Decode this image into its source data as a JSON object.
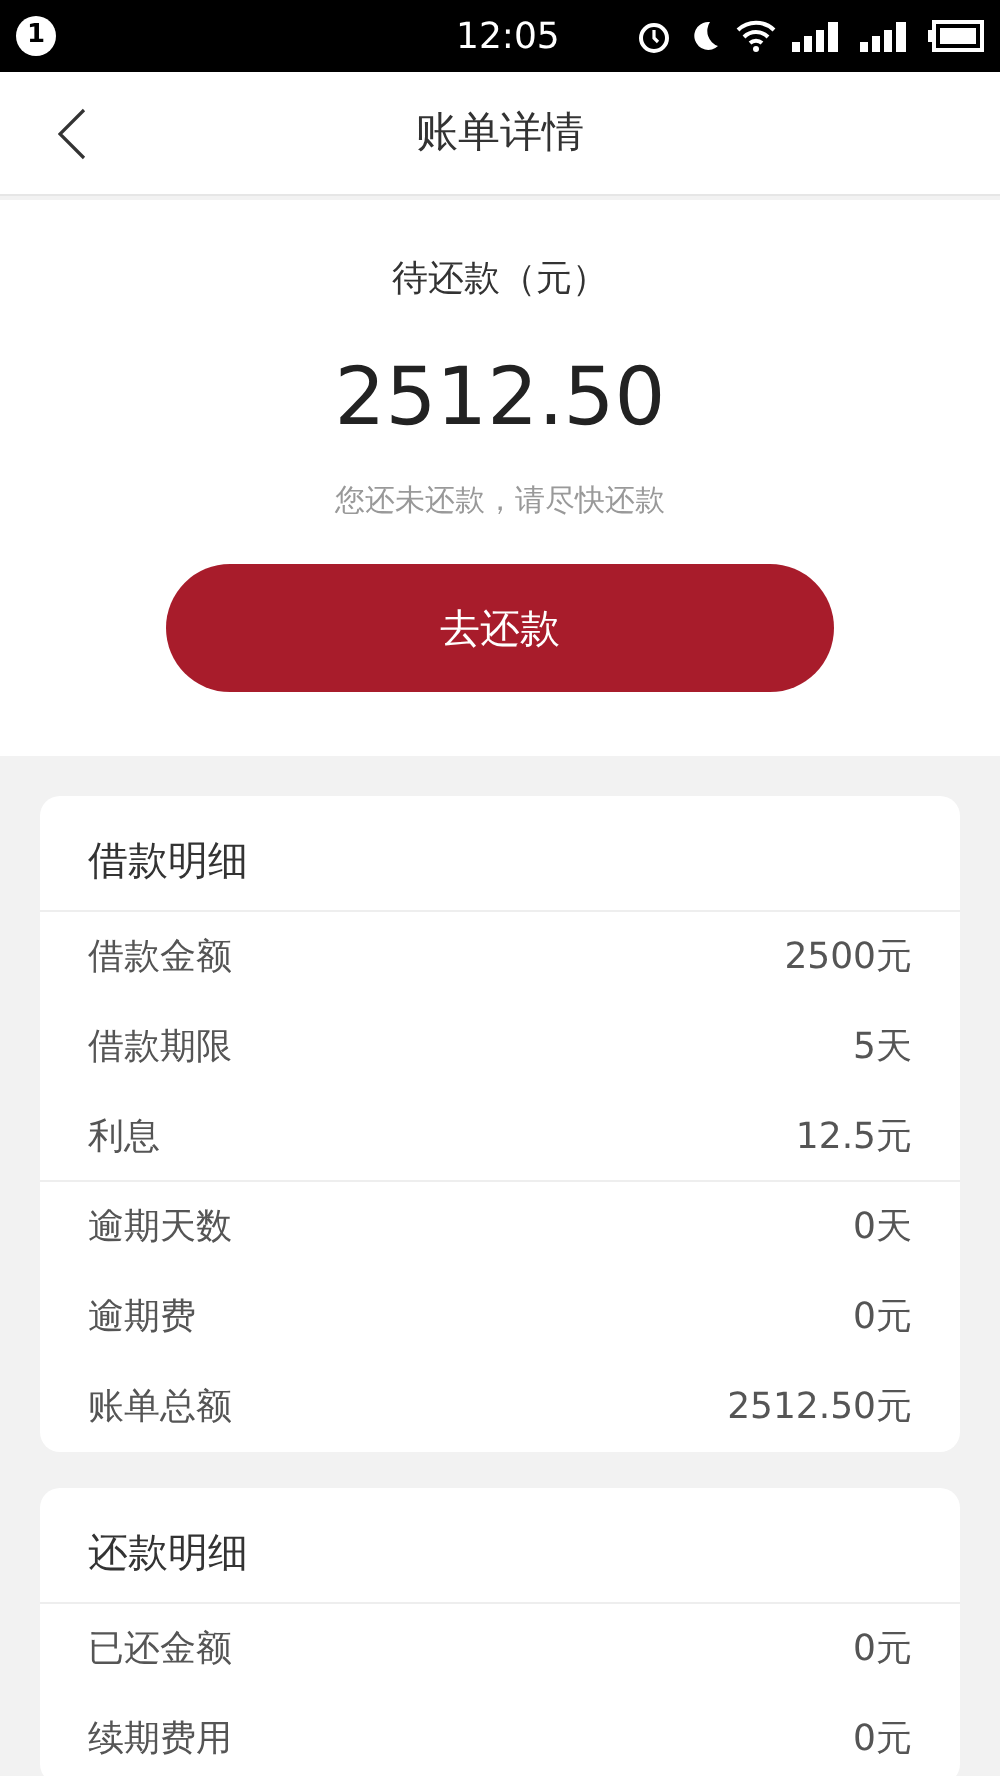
{
  "status_bar": {
    "notification": "1",
    "time": "12:05"
  },
  "header": {
    "title": "账单详情"
  },
  "summary": {
    "label": "待还款（元）",
    "amount": "2512.50",
    "hint": "您还未还款，请尽快还款",
    "button": "去还款"
  },
  "sections": [
    {
      "title": "借款明细",
      "rows": [
        {
          "label": "借款金额",
          "value": "2500元"
        },
        {
          "label": "借款期限",
          "value": "5天"
        },
        {
          "label": "利息",
          "value": "12.5元"
        },
        {
          "label": "逾期天数",
          "value": "0天"
        },
        {
          "label": "逾期费",
          "value": "0元"
        },
        {
          "label": "账单总额",
          "value": "2512.50元"
        }
      ]
    },
    {
      "title": "还款明细",
      "rows": [
        {
          "label": "已还金额",
          "value": "0元"
        },
        {
          "label": "续期费用",
          "value": "0元"
        }
      ]
    }
  ]
}
